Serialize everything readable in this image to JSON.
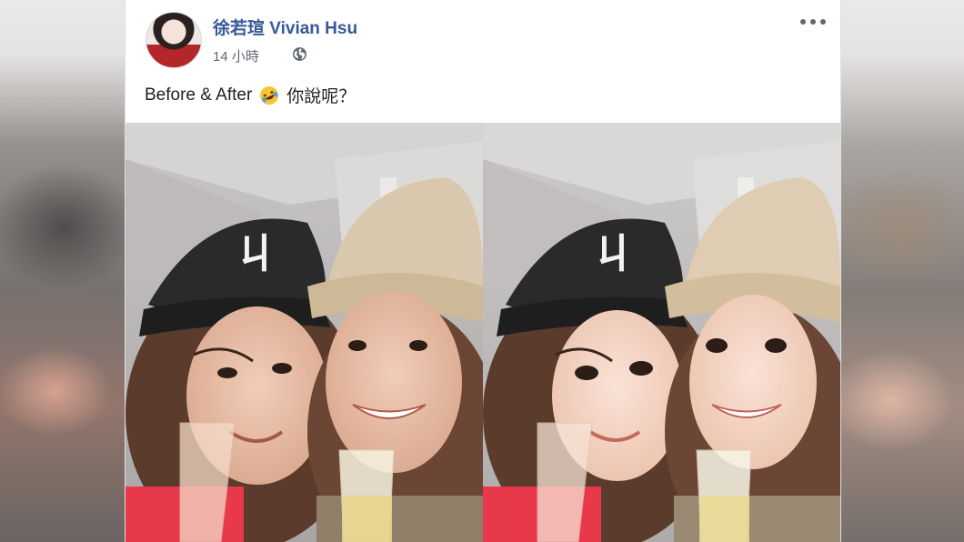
{
  "post": {
    "author": "徐若瑄 Vivian Hsu",
    "timestamp": "14 小時",
    "text_before": "Before & After",
    "text_after": "你說呢？",
    "icons": {
      "privacy": "globe-icon",
      "more": "more-options-icon",
      "emoji": "rolling-on-floor-laughing-emoji"
    }
  },
  "colors": {
    "author_link": "#385898",
    "meta_text": "#616770",
    "body_text": "#1c1e21",
    "card_bg": "#ffffff"
  }
}
